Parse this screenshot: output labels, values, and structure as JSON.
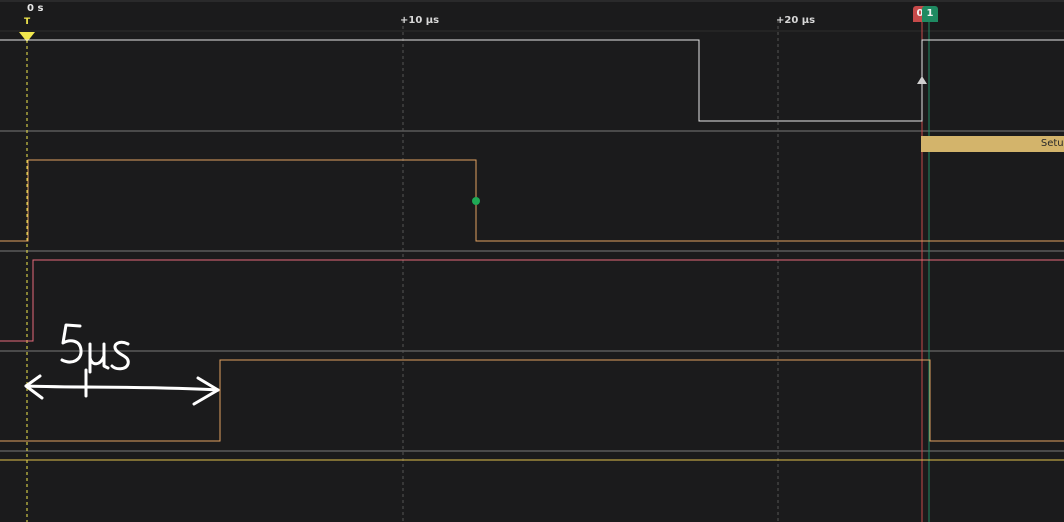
{
  "timeline": {
    "origin_label": "0 s",
    "trigger_letter": "T",
    "ticks": [
      "+10 µs",
      "+20 µs"
    ]
  },
  "markers": {
    "marker_a": "0",
    "marker_b": "1"
  },
  "annotation": {
    "handwritten_text": "5µs"
  },
  "decoder": {
    "label": "Setup"
  },
  "colors": {
    "background": "#1b1b1c",
    "channel_white": "#e6e6e6",
    "channel_orange": "#e0a060",
    "channel_red": "#e66a7a",
    "channel_yellow": "#e2c04c",
    "trigger": "#f1e84e",
    "decoder_bg": "#d3b46b",
    "marker_red": "#c64a4a",
    "marker_green": "#1f8a62"
  }
}
